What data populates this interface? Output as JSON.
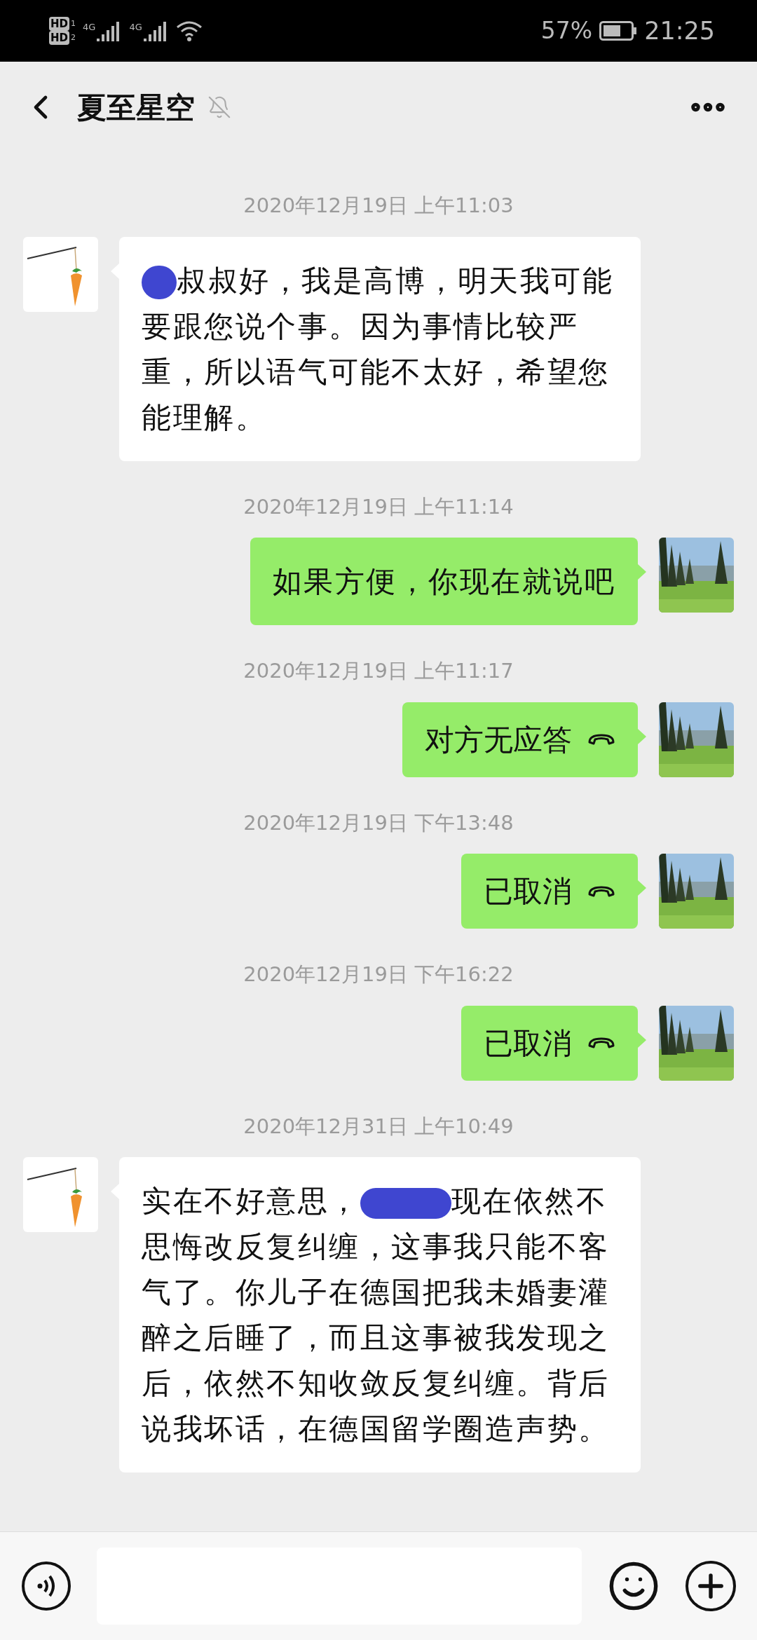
{
  "status_bar": {
    "sim_labels": [
      "HD",
      "1",
      "HD",
      "2"
    ],
    "network_labels": [
      "4G",
      "4G"
    ],
    "battery": "57%",
    "time": "21:25"
  },
  "header": {
    "title": "夏至星空",
    "muted": true
  },
  "messages": [
    {
      "kind": "time",
      "text": "2020年12月19日 上午11:03"
    },
    {
      "kind": "text",
      "outgoing": false,
      "parts": [
        {
          "kind": "blot"
        },
        {
          "kind": "text",
          "text": "叔叔好，我是高博，明天我可能要跟您说个事。因为事情比较严重，所以语气可能不太好，希望您能理解。"
        }
      ]
    },
    {
      "kind": "time",
      "text": "2020年12月19日 上午11:14"
    },
    {
      "kind": "text",
      "outgoing": true,
      "parts": [
        {
          "kind": "text",
          "text": "如果方便，你现在就说吧"
        }
      ]
    },
    {
      "kind": "time",
      "text": "2020年12月19日 上午11:17"
    },
    {
      "kind": "call",
      "outgoing": true,
      "text": "对方无应答"
    },
    {
      "kind": "time",
      "text": "2020年12月19日 下午13:48"
    },
    {
      "kind": "call",
      "outgoing": true,
      "text": "已取消"
    },
    {
      "kind": "time",
      "text": "2020年12月19日 下午16:22"
    },
    {
      "kind": "call",
      "outgoing": true,
      "text": "已取消"
    },
    {
      "kind": "time",
      "text": "2020年12月31日 上午10:49"
    },
    {
      "kind": "text",
      "outgoing": false,
      "parts": [
        {
          "kind": "text",
          "text": "实在不好意思，"
        },
        {
          "kind": "bar"
        },
        {
          "kind": "text",
          "text": "现在依然不思悔改反复纠缠，这事我只能不客气了。你儿子在德国把我未婚妻灌醉之后睡了，而且这事被我发现之后，依然不知收敛反复纠缠。背后说我坏话，在德国留学圈造声势。"
        }
      ]
    }
  ]
}
